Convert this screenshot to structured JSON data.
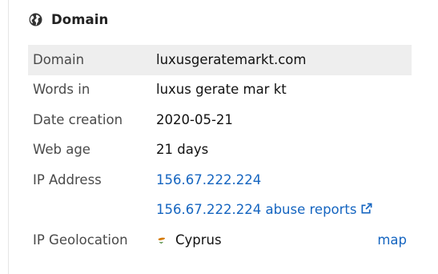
{
  "panel": {
    "title": "Domain",
    "icon": "globe-icon"
  },
  "rows": {
    "domain": {
      "label": "Domain",
      "value": "luxusgeratemarkt.com"
    },
    "words_in": {
      "label": "Words in",
      "value": "luxus gerate mar kt"
    },
    "date_creation": {
      "label": "Date creation",
      "value": "2020-05-21"
    },
    "web_age": {
      "label": "Web age",
      "value": "21 days"
    },
    "ip_address": {
      "label": "IP Address",
      "value": "156.67.222.224",
      "abuse_link": "156.67.222.224 abuse reports",
      "abuse_icon": "external-link-icon"
    },
    "ip_geolocation": {
      "label": "IP Geolocation",
      "country": "Cyprus",
      "flag_icon": "cyprus-flag-icon",
      "map_link": "map"
    }
  },
  "colors": {
    "link": "#1565c0",
    "shaded_row": "#eeeeee",
    "label": "#4a4a4a"
  }
}
